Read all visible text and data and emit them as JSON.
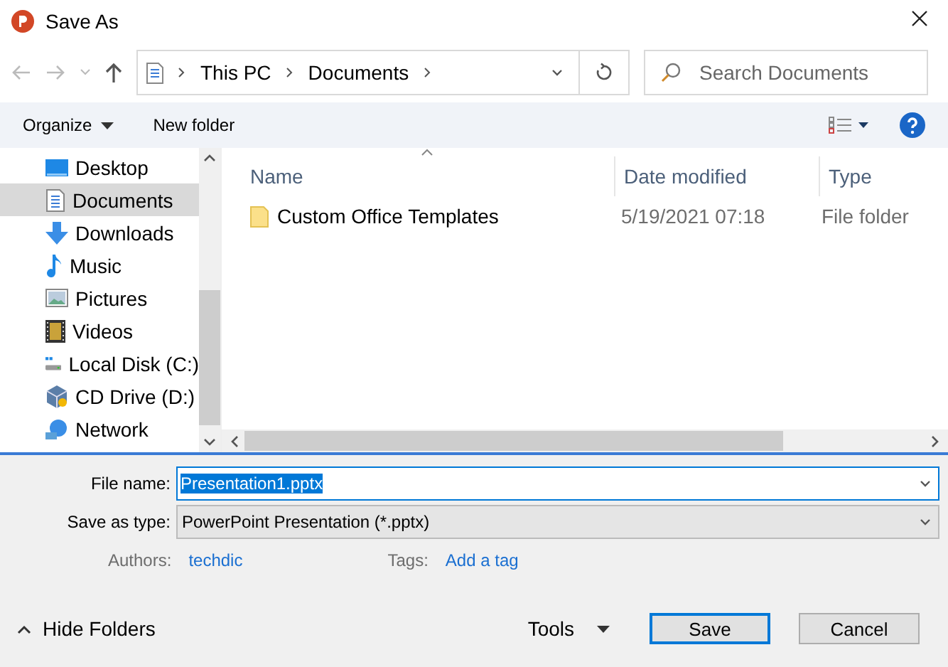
{
  "window": {
    "title": "Save As"
  },
  "address_bar": {
    "path": [
      "This PC",
      "Documents"
    ]
  },
  "search": {
    "placeholder": "Search Documents"
  },
  "toolbar": {
    "organize": "Organize",
    "new_folder": "New folder"
  },
  "sidebar": {
    "items": [
      {
        "label": "Desktop",
        "kind": "desktop",
        "selected": false
      },
      {
        "label": "Documents",
        "kind": "documents",
        "selected": true
      },
      {
        "label": "Downloads",
        "kind": "downloads",
        "selected": false
      },
      {
        "label": "Music",
        "kind": "music",
        "selected": false
      },
      {
        "label": "Pictures",
        "kind": "pictures",
        "selected": false
      },
      {
        "label": "Videos",
        "kind": "videos",
        "selected": false
      },
      {
        "label": "Local Disk (C:)",
        "kind": "disk",
        "selected": false
      },
      {
        "label": "CD Drive (D:)",
        "kind": "cd",
        "selected": false
      },
      {
        "label": "Network",
        "kind": "network",
        "selected": false
      }
    ]
  },
  "file_list": {
    "columns": [
      "Name",
      "Date modified",
      "Type"
    ],
    "rows": [
      {
        "name": "Custom Office Templates",
        "date_modified": "5/19/2021 07:18",
        "type": "File folder"
      }
    ]
  },
  "form": {
    "file_name": {
      "label": "File name:",
      "value": "Presentation1.pptx"
    },
    "save_as_type": {
      "label": "Save as type:",
      "value": "PowerPoint Presentation (*.pptx)"
    },
    "authors": {
      "label": "Authors:",
      "value": "techdic"
    },
    "tags": {
      "label": "Tags:",
      "value": "Add a tag"
    }
  },
  "footer": {
    "hide_folders": "Hide Folders",
    "tools": "Tools",
    "buttons": [
      {
        "label": "Save",
        "default": true
      },
      {
        "label": "Cancel",
        "default": false
      }
    ]
  }
}
